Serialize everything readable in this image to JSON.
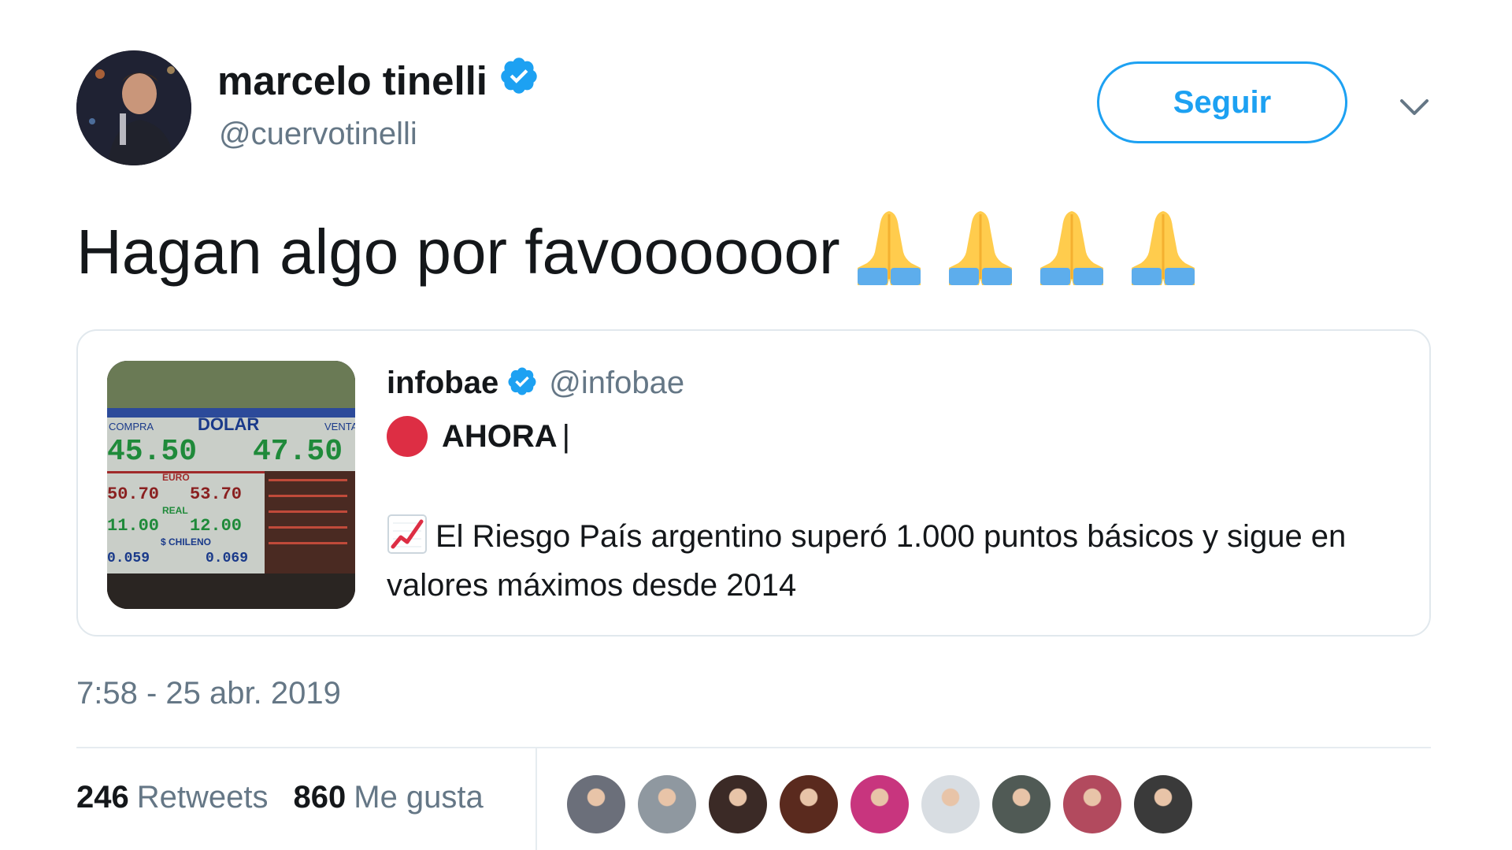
{
  "author": {
    "display_name": "marcelo tinelli",
    "handle": "@cuervotinelli",
    "verified": true,
    "avatar": "avatar-photo"
  },
  "actions": {
    "follow_label": "Seguir",
    "menu_icon": "chevron-down-icon"
  },
  "tweet": {
    "text": "Hagan algo por favoooooor",
    "emoji": [
      "folded-hands",
      "folded-hands",
      "folded-hands",
      "folded-hands"
    ]
  },
  "quote": {
    "display_name": "infobae",
    "handle": "@infobae",
    "verified": true,
    "headline_emoji": "red-circle",
    "headline": "AHORA",
    "separator": "|",
    "body_emoji": "chart-increasing",
    "body": "El Riesgo País argentino superó 1.000 puntos básicos y sigue en valores máximos desde 2014",
    "media": {
      "board_title": "DOLAR",
      "compra_label": "COMPRA",
      "venta_label": "VENTA",
      "dolar_compra": "45.50",
      "dolar_venta": "47.50",
      "euro_label": "EURO",
      "euro_compra": "50.70",
      "euro_venta": "53.70",
      "real_label": "REAL",
      "real_compra": "11.00",
      "real_venta": "12.00",
      "chileno_label": "$ CHILENO",
      "chileno_compra": "0.059",
      "chileno_venta": "0.069"
    }
  },
  "timestamp": "7:58 - 25 abr. 2019",
  "stats": {
    "retweets_count": "246",
    "retweets_label": "Retweets",
    "likes_count": "860",
    "likes_label": "Me gusta"
  },
  "liker_colors": [
    "#6b6f7a",
    "#8f98a0",
    "#3b2a26",
    "#5a2a1e",
    "#c8357e",
    "#d8dde2",
    "#505a55",
    "#b24a5e",
    "#3a3a3a"
  ]
}
